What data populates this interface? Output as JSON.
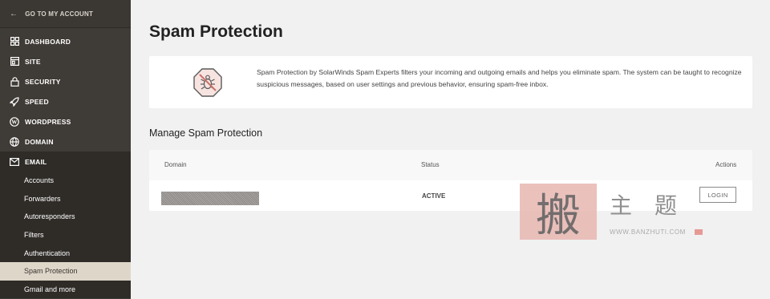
{
  "sidebar": {
    "back_label": "GO TO MY ACCOUNT",
    "nav": [
      {
        "label": "DASHBOARD",
        "icon": "grid-icon"
      },
      {
        "label": "SITE",
        "icon": "site-icon"
      },
      {
        "label": "SECURITY",
        "icon": "lock-icon"
      },
      {
        "label": "SPEED",
        "icon": "rocket-icon"
      },
      {
        "label": "WORDPRESS",
        "icon": "wordpress-icon"
      },
      {
        "label": "DOMAIN",
        "icon": "globe-icon"
      },
      {
        "label": "EMAIL",
        "icon": "envelope-icon"
      }
    ],
    "email_sub": [
      "Accounts",
      "Forwarders",
      "Autoresponders",
      "Filters",
      "Authentication",
      "Spam Protection",
      "Gmail and more"
    ],
    "selected_sub": "Spam Protection"
  },
  "main": {
    "title": "Spam Protection",
    "intro": "Spam Protection by SolarWinds Spam Experts filters your incoming and outgoing emails and helps you eliminate spam. The system can be taught to recognize suspicious messages, based on user settings and previous behavior, ensuring spam-free inbox.",
    "intro_icon": "no-bug-icon",
    "section_title": "Manage Spam Protection",
    "table": {
      "columns": [
        "Domain",
        "Status",
        "Actions"
      ],
      "rows": [
        {
          "domain": "",
          "status": "ACTIVE",
          "action": "LOGIN"
        }
      ]
    }
  },
  "watermark": {
    "seal_char": "搬",
    "text": "主题",
    "url": "WWW.BANZHUTI.COM"
  },
  "colors": {
    "sidebar_bg": "#3f3b36",
    "sidebar_active_bg": "#2f2c28",
    "selected_item_bg": "#ded6c9",
    "page_bg": "#f1f1f1"
  }
}
